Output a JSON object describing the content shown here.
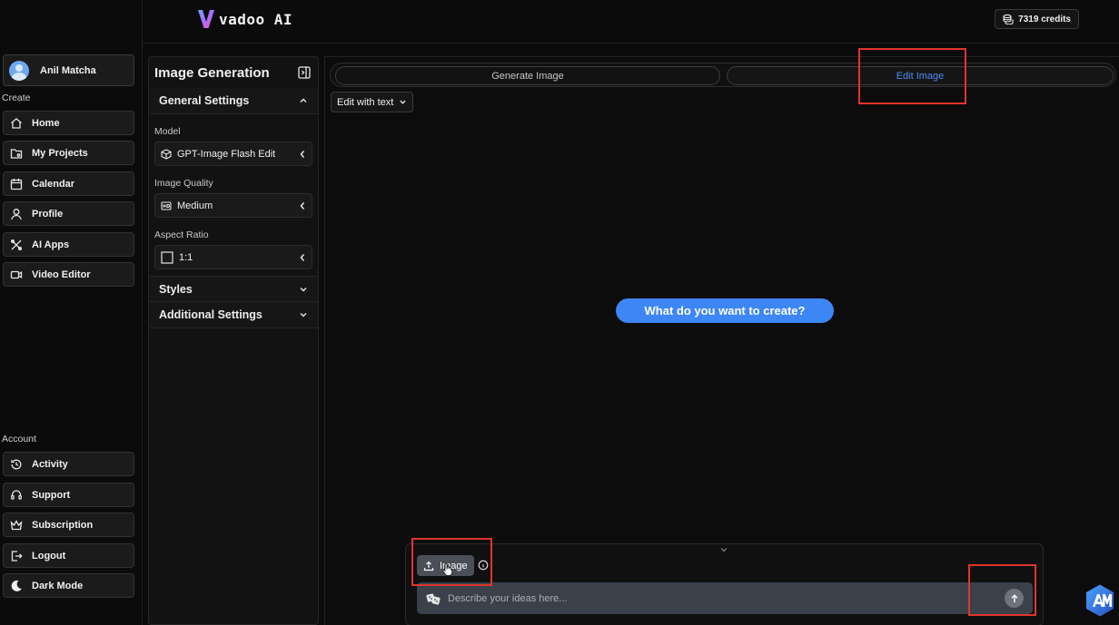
{
  "app": {
    "logo_text": "vadoo AI",
    "credits": "7319 credits"
  },
  "sidebar": {
    "user_name": "Anil Matcha",
    "create_label": "Create",
    "account_label": "Account",
    "create_items": [
      {
        "label": "Home",
        "icon": "home-icon"
      },
      {
        "label": "My Projects",
        "icon": "folder-icon"
      },
      {
        "label": "Calendar",
        "icon": "calendar-icon"
      },
      {
        "label": "Profile",
        "icon": "user-icon"
      },
      {
        "label": "AI Apps",
        "icon": "tools-icon"
      },
      {
        "label": "Video Editor",
        "icon": "video-icon"
      }
    ],
    "account_items": [
      {
        "label": "Activity",
        "icon": "history-icon"
      },
      {
        "label": "Support",
        "icon": "headset-icon"
      },
      {
        "label": "Subscription",
        "icon": "crown-icon"
      },
      {
        "label": "Logout",
        "icon": "logout-icon"
      },
      {
        "label": "Dark Mode",
        "icon": "moon-icon"
      }
    ]
  },
  "panel": {
    "title": "Image Generation",
    "general_settings": "General Settings",
    "model_label": "Model",
    "model_value": "GPT-Image Flash Edit",
    "quality_label": "Image Quality",
    "quality_value": "Medium",
    "aspect_label": "Aspect Ratio",
    "aspect_value": "1:1",
    "styles": "Styles",
    "additional_settings": "Additional Settings"
  },
  "main": {
    "tabs": [
      {
        "label": "Generate Image",
        "active": false
      },
      {
        "label": "Edit Image",
        "active": true
      }
    ],
    "mode_select": "Edit with text",
    "cta": "What do you want to create?",
    "image_button": "Image",
    "prompt_placeholder": "Describe your ideas here..."
  },
  "colors": {
    "accent": "#3d86f5",
    "active_tab_text": "#4c8ef7",
    "highlight": "#e0352b"
  }
}
